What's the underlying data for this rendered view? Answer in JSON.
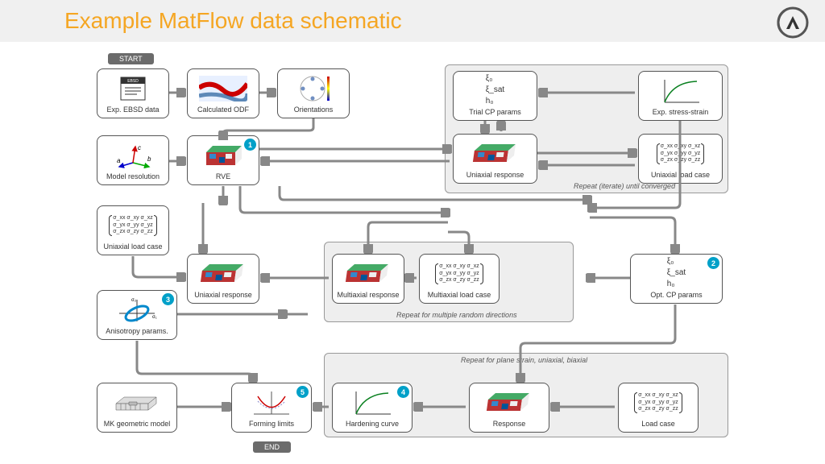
{
  "title": "Example MatFlow data schematic",
  "start": "START",
  "end": "END",
  "groups": {
    "g1": "Repeat (iterate) until converged",
    "g2": "Repeat for multiple random directions",
    "g3": "Repeat for plane strain, uniaxial, biaxial"
  },
  "nodes": {
    "ebsd": "Exp. EBSD data",
    "odf": "Calculated ODF",
    "orient": "Orientations",
    "trialcp": "Trial CP params",
    "expss": "Exp. stress-strain",
    "modelres": "Model resolution",
    "rve": "RVE",
    "uniresp1": "Uniaxial response",
    "uload1": "Uniaxial load case",
    "uload2": "Uniaxial load case",
    "uniresp2": "Uniaxial response",
    "multir": "Multiaxial response",
    "multil": "Multiaxial load case",
    "optcp": "Opt. CP params",
    "aniso": "Anisotropy params.",
    "mk": "MK geometric model",
    "forming": "Forming limits",
    "harden": "Hardening curve",
    "response": "Response",
    "loadcase": "Load case"
  },
  "cp_params": {
    "l1": "ξ₀",
    "l2": "ξ_sat",
    "l3": "h₀"
  },
  "tensor": {
    "r1": "σ_xx  σ_xy  σ_xz",
    "r2": "σ_yx  σ_yy  σ_yz",
    "r3": "σ_zx  σ_zy  σ_zz"
  },
  "badges": {
    "rve": "1",
    "optcp": "2",
    "aniso": "3",
    "harden": "4",
    "forming": "5"
  }
}
